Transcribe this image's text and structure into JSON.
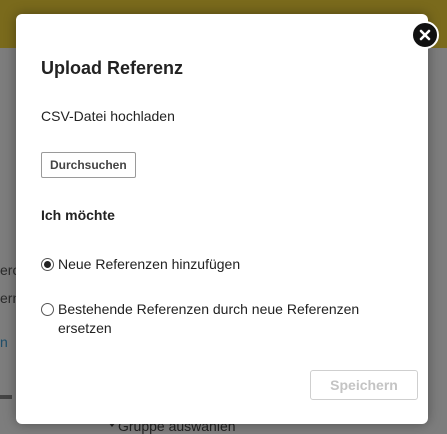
{
  "background": {
    "fragments": [
      "erc",
      "ern"
    ],
    "link_fragment": "n",
    "bottom_text": "Gruppe auswählen"
  },
  "modal": {
    "close_icon": "close-icon",
    "title": "Upload Referenz",
    "file_label": "CSV-Datei hochladen",
    "browse_label": "Durchsuchen",
    "section_label": "Ich möchte",
    "options": [
      {
        "label": "Neue Referenzen hinzufügen",
        "checked": true
      },
      {
        "label": "Bestehende Referenzen durch neue Referenzen ersetzen",
        "checked": false
      }
    ],
    "save_label": "Speichern",
    "save_disabled": true
  },
  "colors": {
    "overlay": "#7d7d7d",
    "topbar": "#7a6a1c",
    "close_button": "#111111",
    "disabled_text": "#c4c4c4"
  }
}
